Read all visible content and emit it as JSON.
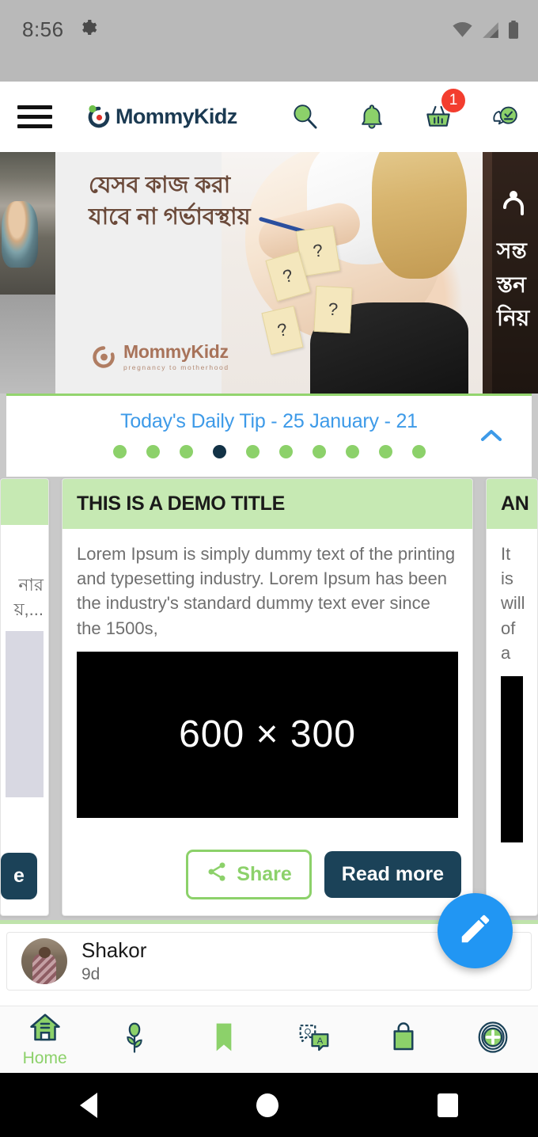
{
  "status_bar": {
    "time": "8:56",
    "icons": [
      "gear-icon",
      "wifi-icon",
      "cellular-signal-icon",
      "battery-icon"
    ]
  },
  "app_bar": {
    "menu_icon": "hamburger-menu-icon",
    "brand": "MommyKidz",
    "icons": [
      {
        "name": "search-icon",
        "label": "Search"
      },
      {
        "name": "bell-icon",
        "label": "Notifications"
      },
      {
        "name": "basket-icon",
        "label": "Cart",
        "badge": "1"
      },
      {
        "name": "chat-check-icon",
        "label": "Messages"
      }
    ],
    "cart_badge": "1"
  },
  "banner": {
    "left_peek_alt": "village-photo",
    "main": {
      "title_line1": "যেসব কাজ করা",
      "title_line2": "যাবে না গর্ভাবস্থায়",
      "logo_text": "MommyKidz",
      "logo_tagline": "pregnancy to motherhood",
      "sticky_notes": [
        "?",
        "?",
        "?",
        "?"
      ]
    },
    "right_peek": {
      "line1": "সন্ত",
      "line2": "স্তন",
      "line3": "নিয়"
    }
  },
  "daily_tip": {
    "title": "Today's Daily Tip - 25 January - 21",
    "dots_total": 10,
    "active_dot_index": 3,
    "collapse_icon": "chevron-up-icon"
  },
  "cards": {
    "left_partial": {
      "title": "",
      "text_line1": "নার",
      "text_line2": "য়,...",
      "read_more": "e"
    },
    "main": {
      "title": "THIS IS A DEMO TITLE",
      "text": "Lorem Ipsum is simply dummy text of the printing and typesetting industry. Lorem Ipsum has been the industry's standard dummy text ever since the 1500s,",
      "image_placeholder": "600 × 300",
      "share_label": "Share",
      "read_more_label": "Read more"
    },
    "right_partial": {
      "title": "AN",
      "text_line1": "It is",
      "text_line2": "will",
      "text_line3": "of a"
    }
  },
  "feed": {
    "post": {
      "author": "Shakor",
      "time": "9d"
    }
  },
  "fab": {
    "icon": "pencil-icon"
  },
  "bottom_nav": {
    "items": [
      {
        "name": "home",
        "icon": "home-icon",
        "label": "Home",
        "active": true
      },
      {
        "name": "pregnancy",
        "icon": "flower-icon",
        "label": ""
      },
      {
        "name": "bookmarks",
        "icon": "bookmark-icon",
        "label": ""
      },
      {
        "name": "qa",
        "icon": "qa-chat-icon",
        "label": ""
      },
      {
        "name": "shop",
        "icon": "shopping-bag-icon",
        "label": ""
      },
      {
        "name": "add",
        "icon": "plus-circle-icon",
        "label": ""
      }
    ]
  },
  "android_nav": {
    "back": "back-triangle-icon",
    "home": "home-circle-icon",
    "recents": "recents-square-icon"
  },
  "colors": {
    "brand_navy": "#1b3a52",
    "brand_green": "#8cd16a",
    "accent_blue": "#3d9ae8",
    "badge_red": "#f33d2e",
    "card_head_green": "#c6e9b3",
    "fab_blue": "#2196f3"
  }
}
